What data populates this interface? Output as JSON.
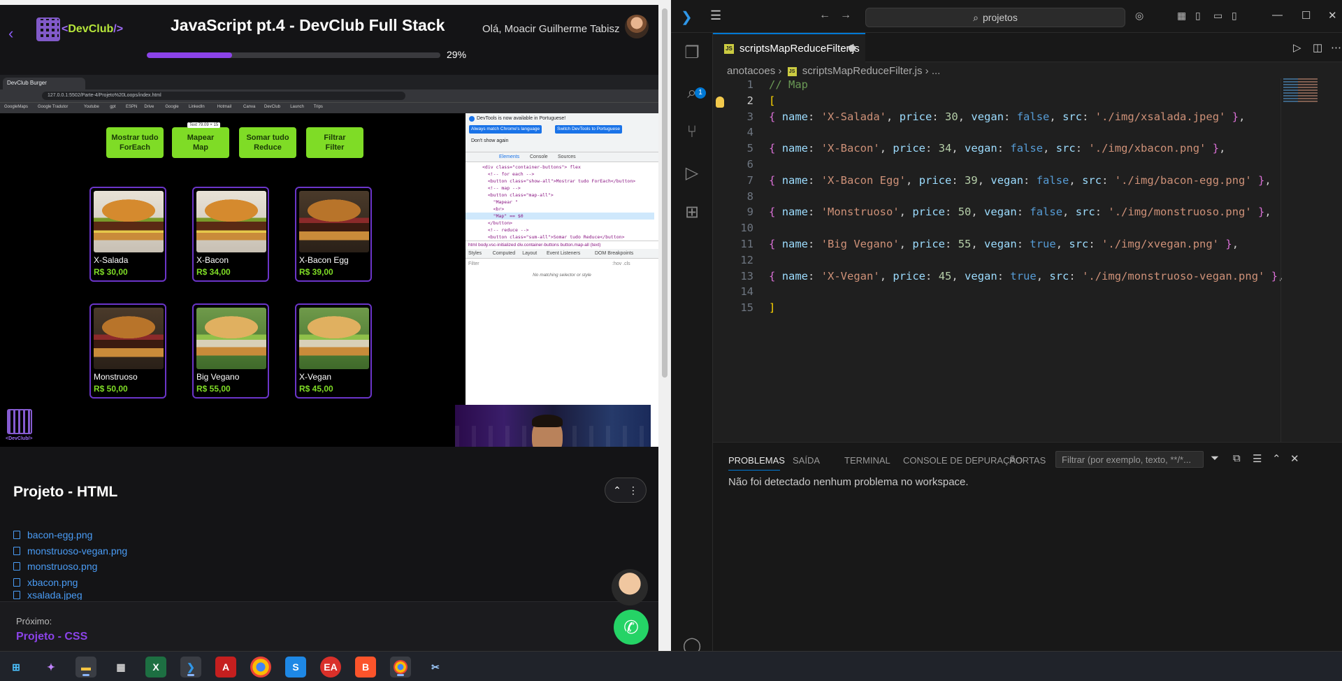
{
  "course": {
    "logo_text": "<DevClub/>",
    "logo_lt": "<",
    "logo_name": "DevClub",
    "logo_end": "/>",
    "title": "JavaScript pt.4 - DevClub Full Stack",
    "greeting": "Olá, Moacir Guilherme Tabisz",
    "progress_percent": 29,
    "progress_label": "29%"
  },
  "video": {
    "browser_tab": "DevClub Burger",
    "address": "127.0.0.1:5502/Parte-4/Projeto%20Loops/index.html",
    "bookmarks": [
      "GoogleMaps",
      "Google Tradutor",
      "Youtube",
      "gpt",
      "ESPN",
      "Drive",
      "Google",
      "LinkedIn",
      "Hotmail",
      "Canva",
      "DevClub",
      "Launch",
      "Trips"
    ],
    "site_buttons": [
      "Mostrar tudo\nForEach",
      "Mapear\nMap",
      "Somar tudo\nReduce",
      "Filtrar\nFilter"
    ],
    "tooltip": "Text 79.09 × 15",
    "products": [
      {
        "name": "X-Salada",
        "price": "R$ 30,00"
      },
      {
        "name": "X-Bacon",
        "price": "R$ 34,00"
      },
      {
        "name": "X-Bacon Egg",
        "price": "R$ 39,00"
      },
      {
        "name": "Monstruoso",
        "price": "R$ 50,00"
      },
      {
        "name": "Big Vegano",
        "price": "R$ 55,00"
      },
      {
        "name": "X-Vegan",
        "price": "R$ 45,00"
      }
    ],
    "site_logo_text": "<DevClub/>",
    "devtools": {
      "info": "DevTools is now available in Portuguese!",
      "btn1": "Always match Chrome's language",
      "btn2": "Switch DevTools to Portuguese",
      "dont_show": "Don't show again",
      "tabs": [
        "Elements",
        "Console",
        "Sources"
      ],
      "code_lines": [
        "<div class=\"container-buttons\"> flex",
        "  <!-- for each -->",
        "  <button class=\"show-all\">Mostrar tudo ForEach</button>",
        "  <!-- map -->",
        "  <button class=\"map-all\">",
        "    \"Mapear \"",
        "    <br>",
        "    \"Map\" == $0",
        "  </button>",
        "  <!-- reduce -->",
        "  <button class=\"sum-all\">Somar tudo Reduce</button>"
      ],
      "crumbs": "html  body.vsc-initialized  div.container-buttons  button.map-all  (text)",
      "subtabs": [
        "Styles",
        "Computed",
        "Layout",
        "Event Listeners",
        "DOM Breakpoints"
      ],
      "filter": "Filter",
      "filter_hint": ":hov .cls",
      "no_match": "No matching selector or style"
    }
  },
  "lesson": {
    "title": "Projeto - HTML",
    "files": [
      "bacon-egg.png",
      "monstruoso-vegan.png",
      "monstruoso.png",
      "xbacon.png",
      "xsalada.jpeg"
    ],
    "next_label": "Próximo:",
    "next_name": "Projeto - CSS"
  },
  "vscode": {
    "search": "projetos",
    "tab_file": "scriptsMapReduceFilter.js",
    "breadcrumb": [
      "anotacoes",
      "scriptsMapReduceFilter.js",
      "..."
    ],
    "line_numbers": [
      "1",
      "2",
      "3",
      "4",
      "5",
      "6",
      "7",
      "8",
      "9",
      "10",
      "11",
      "12",
      "13",
      "14",
      "15"
    ],
    "code": {
      "l1": "// Map",
      "l2": "[",
      "items": [
        {
          "name": "'X-Salada'",
          "price": "30",
          "vegan": "false",
          "src": "'./img/xsalada.jpeg'"
        },
        {
          "name": "'X-Bacon'",
          "price": "34",
          "vegan": "false",
          "src": "'./img/xbacon.png'"
        },
        {
          "name": "'X-Bacon Egg'",
          "price": "39",
          "vegan": "false",
          "src": "'./img/bacon-egg.png'"
        },
        {
          "name": "'Monstruoso'",
          "price": "50",
          "vegan": "false",
          "src": "'./img/monstruoso.png'"
        },
        {
          "name": "'Big Vegano'",
          "price": "55",
          "vegan": "true",
          "src": "'./img/xvegan.png'"
        },
        {
          "name": "'X-Vegan'",
          "price": "45",
          "vegan": "true",
          "src": "'./img/monstruoso-vegan.png'"
        }
      ],
      "l15": "]"
    },
    "panel_tabs": [
      "PROBLEMAS",
      "SAÍDA",
      "TERMINAL",
      "CONSOLE DE DEPURAÇÃO",
      "PORTAS"
    ],
    "panel_filter": "Filtrar (por exemplo, texto, **/*...",
    "panel_message": "Não foi detectado nenhum problema no workspace.",
    "activity_badge": "1"
  },
  "taskbar": {
    "apps": [
      "windows-start",
      "copilot",
      "file-explorer",
      "calculator",
      "excel",
      "vscode",
      "acrobat",
      "chrome",
      "app-blue",
      "ea",
      "brave",
      "chrome-profile",
      "app-snip"
    ]
  },
  "colors": {
    "accent_purple": "#8b43e8",
    "devclub_green": "#7fdc26",
    "vscode_blue": "#0078d4",
    "whatsapp": "#25d366"
  }
}
